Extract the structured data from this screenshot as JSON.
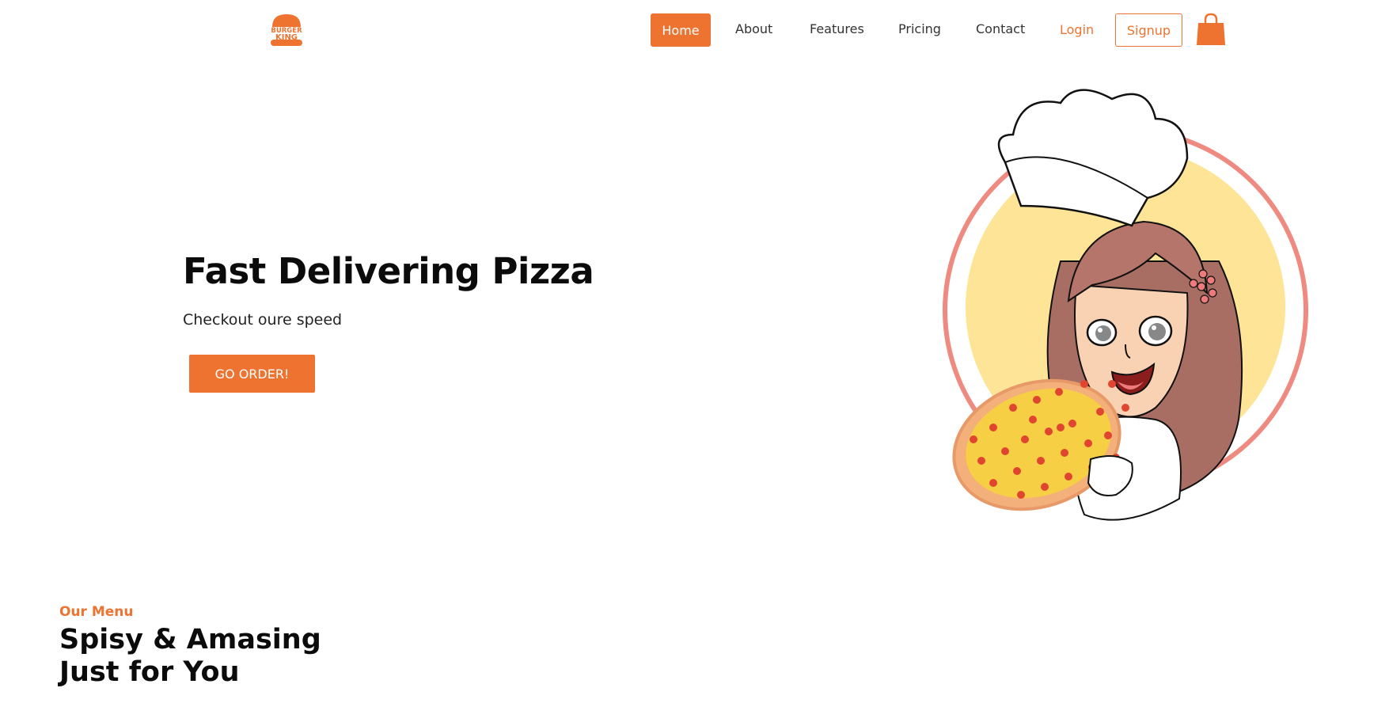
{
  "header": {
    "logo_text_top": "BURGER",
    "logo_text_bottom": "KING",
    "nav": {
      "home": "Home",
      "about": "About",
      "features": "Features",
      "pricing": "Pricing",
      "contact": "Contact",
      "login": "Login",
      "signup": "Signup"
    },
    "cart_icon": "shopping-bag-icon"
  },
  "hero": {
    "title": "Fast Delivering Pizza",
    "subtitle": "Checkout oure speed",
    "cta_label": "GO ORDER!"
  },
  "menu_section": {
    "kicker": "Our Menu",
    "title_line1": "Spisy & Amasing",
    "title_line2": "Just for You"
  },
  "colors": {
    "accent": "#ee7331",
    "ring": "#ee8a7f",
    "circle_fill": "#fde497",
    "hair": "#b5756b"
  }
}
